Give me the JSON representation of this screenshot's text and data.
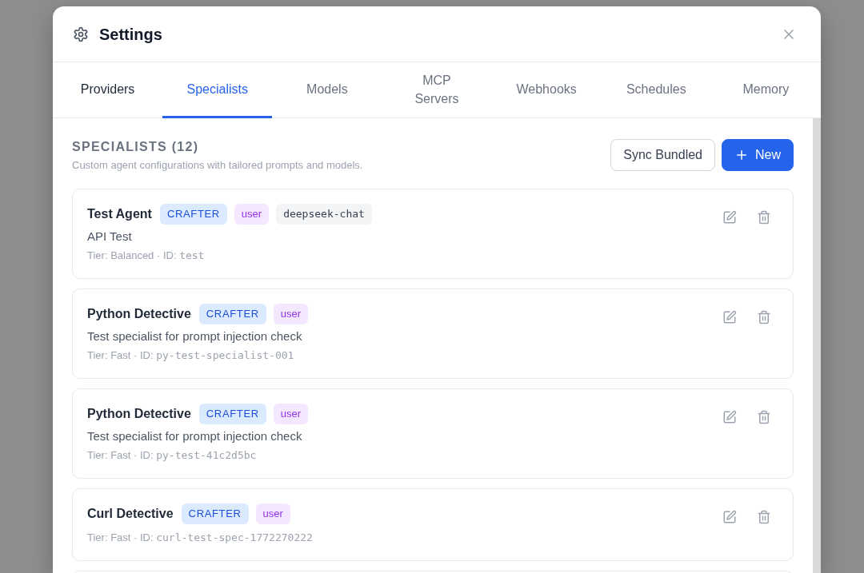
{
  "window": {
    "title": "Settings"
  },
  "tabs": [
    {
      "label": "Providers",
      "selected": false,
      "hovered": true
    },
    {
      "label": "Specialists",
      "selected": true,
      "hovered": false
    },
    {
      "label": "Models",
      "selected": false,
      "hovered": false
    },
    {
      "label": "MCP Servers",
      "selected": false,
      "hovered": false
    },
    {
      "label": "Webhooks",
      "selected": false,
      "hovered": false
    },
    {
      "label": "Schedules",
      "selected": false,
      "hovered": false
    },
    {
      "label": "Memory",
      "selected": false,
      "hovered": false
    }
  ],
  "section": {
    "heading": "SPECIALISTS (12)",
    "subtitle": "Custom agent configurations with tailored prompts and models.",
    "buttons": [
      {
        "label": "Sync Bundled",
        "kind": "secondary"
      },
      {
        "label": "New",
        "kind": "primary"
      }
    ]
  },
  "specialists": [
    {
      "name": "Test Agent",
      "badges": [
        {
          "kind": "role",
          "text": "CRAFTER"
        },
        {
          "kind": "source",
          "text": "user"
        },
        {
          "kind": "model",
          "text": "deepseek-chat"
        }
      ],
      "description": "API Test",
      "meta": "Tier: Balanced · ID:",
      "id": "test"
    },
    {
      "name": "Python Detective",
      "badges": [
        {
          "kind": "role",
          "text": "CRAFTER"
        },
        {
          "kind": "source",
          "text": "user"
        }
      ],
      "description": "Test specialist for prompt injection check",
      "meta": "Tier: Fast · ID:",
      "id": "py-test-specialist-001"
    },
    {
      "name": "Python Detective",
      "badges": [
        {
          "kind": "role",
          "text": "CRAFTER"
        },
        {
          "kind": "source",
          "text": "user"
        }
      ],
      "description": "Test specialist for prompt injection check",
      "meta": "Tier: Fast · ID:",
      "id": "py-test-41c2d5bc"
    },
    {
      "name": "Curl Detective",
      "badges": [
        {
          "kind": "role",
          "text": "CRAFTER"
        },
        {
          "kind": "source",
          "text": "user"
        }
      ],
      "meta": "Tier: Fast · ID:",
      "id": "curl-test-spec-1772270222"
    }
  ]
}
